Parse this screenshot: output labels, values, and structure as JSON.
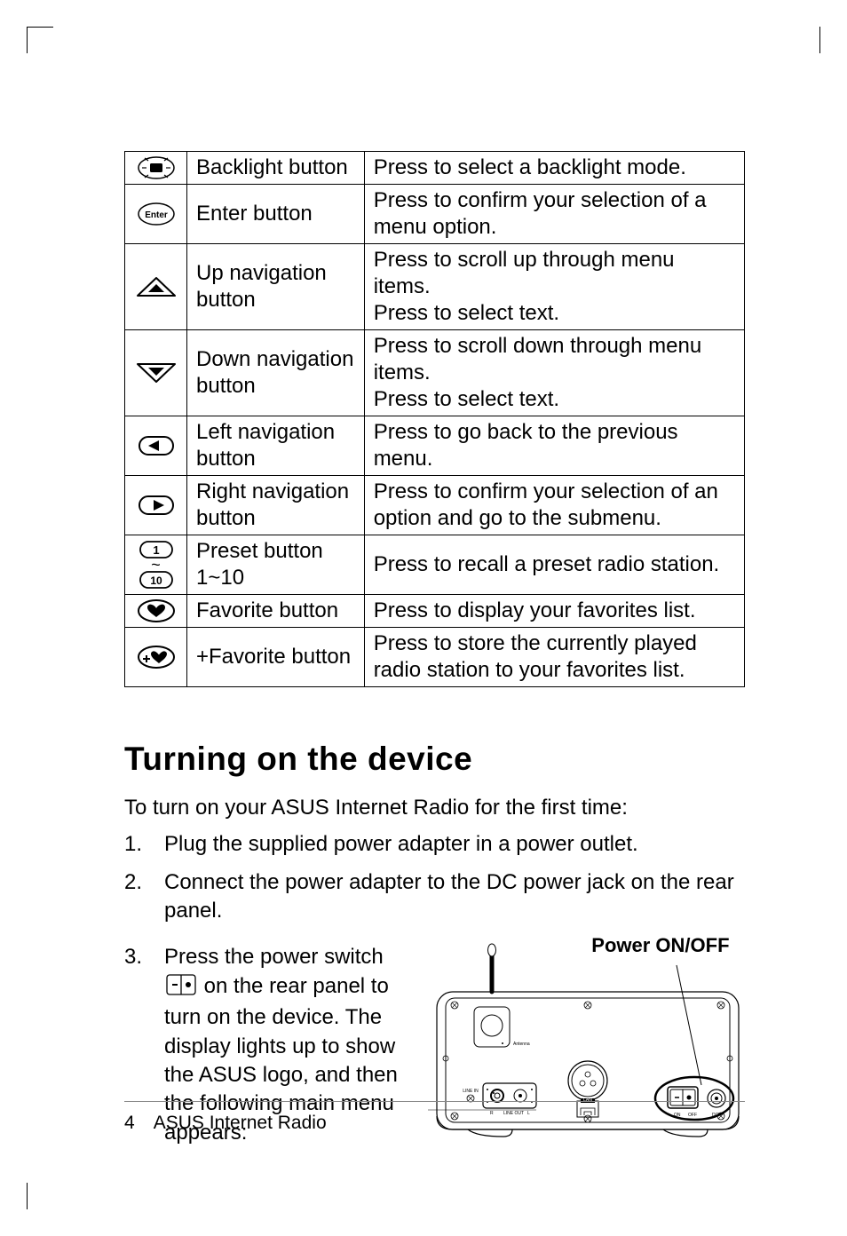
{
  "table": {
    "rows": [
      {
        "name": "Backlight button",
        "desc": "Press to select a backlight mode."
      },
      {
        "name": "Enter button",
        "desc": "Press to confirm your selection of a menu option."
      },
      {
        "name": "Up navigation button",
        "desc": "Press to scroll up through menu items.\nPress to select text."
      },
      {
        "name": "Down navigation button",
        "desc": "Press to scroll down through menu items.\nPress to select text."
      },
      {
        "name": "Left navigation button",
        "desc": "Press to go back to the previous menu."
      },
      {
        "name": "Right navigation button",
        "desc": "Press to confirm your selection of an option and go to the submenu."
      },
      {
        "name": "Preset button 1~10",
        "desc": "Press to recall a preset radio station."
      },
      {
        "name": "Favorite button",
        "desc": "Press to display your favorites list."
      },
      {
        "name": "+Favorite button",
        "desc": "Press to store the currently played radio station to your favorites list."
      }
    ],
    "preset_tilde": "~"
  },
  "section_title": "Turning on the device",
  "intro": "To turn on your ASUS Internet Radio for the first time:",
  "steps": [
    "Plug the supplied power adapter in a power outlet.",
    "Connect the power adapter to the DC power jack on the rear panel."
  ],
  "step3_pre": "Press the power switch ",
  "step3_post": " on the rear panel to turn on the device. The display lights up to show the ASUS logo, and then the following main menu appears:",
  "diagram": {
    "power_label": "Power ON/OFF",
    "antenna": "Antenna",
    "line_in": "LINE IN",
    "line_out": "LINE OUT",
    "lan": "LAN",
    "on": "ON",
    "off": "OFF",
    "dc": "DC",
    "r": "R",
    "l": "L"
  },
  "footer": {
    "page": "4",
    "title": "ASUS Internet Radio"
  }
}
